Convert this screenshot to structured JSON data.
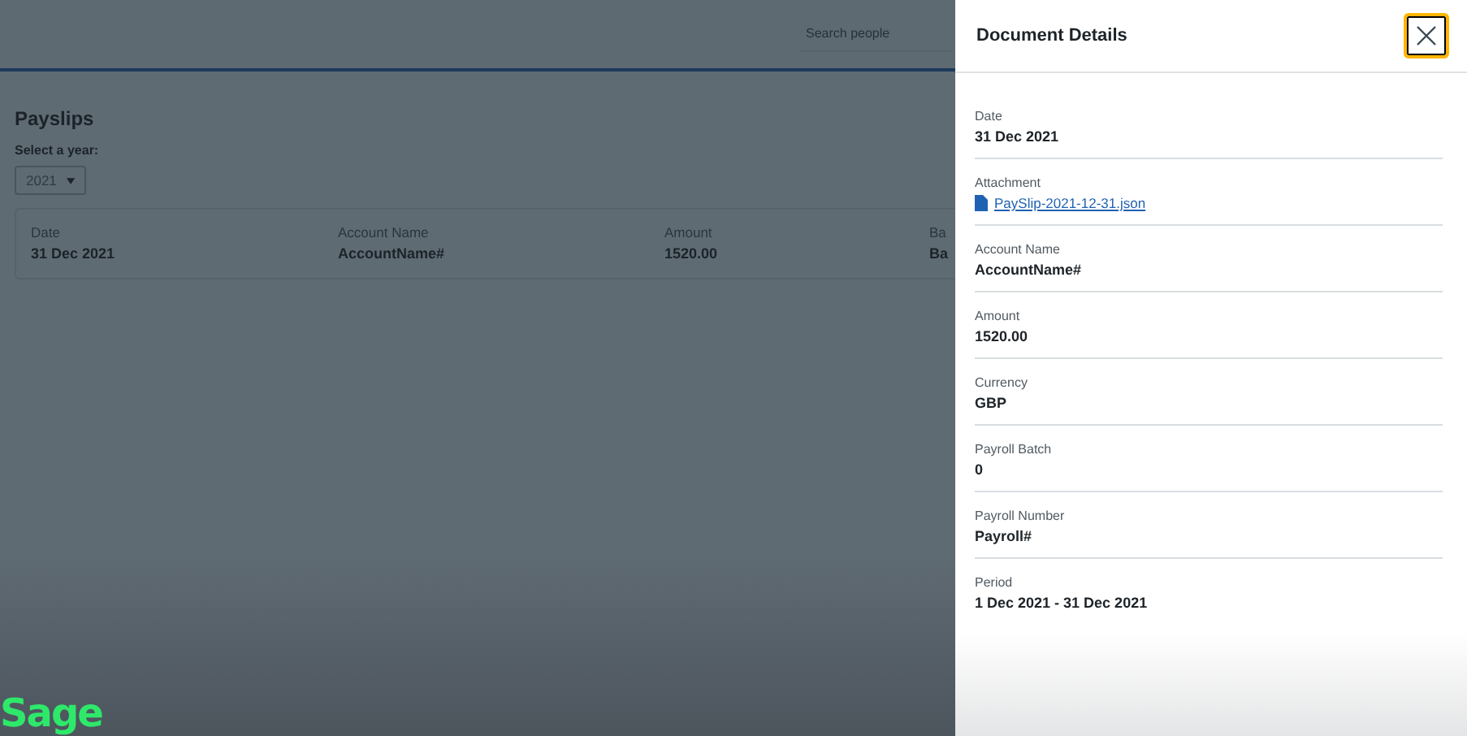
{
  "header": {
    "search": {
      "placeholder": "Search people"
    }
  },
  "payslips": {
    "title": "Payslips",
    "year_label": "Select a year:",
    "year": "2021",
    "columns": [
      "Date",
      "Account Name",
      "Amount",
      "Ba"
    ],
    "rows": [
      [
        "31 Dec 2021",
        "AccountName#",
        "1520.00",
        "Ba"
      ]
    ]
  },
  "logo": "Sage",
  "drawer": {
    "title": "Document Details",
    "close_focused": true,
    "fields": [
      {
        "label": "Date",
        "value": "31 Dec 2021",
        "kind": "text"
      },
      {
        "label": "Attachment",
        "value": "PaySlip-2021-12-31.json",
        "kind": "file"
      },
      {
        "label": "Account Name",
        "value": "AccountName#",
        "kind": "text"
      },
      {
        "label": "Amount",
        "value": "1520.00",
        "kind": "text"
      },
      {
        "label": "Currency",
        "value": "GBP",
        "kind": "text"
      },
      {
        "label": "Payroll Batch",
        "value": "0",
        "kind": "text"
      },
      {
        "label": "Payroll Number",
        "value": "Payroll#",
        "kind": "text"
      },
      {
        "label": "Period",
        "value": "1 Dec 2021 - 31 Dec 2021",
        "kind": "text"
      }
    ]
  }
}
